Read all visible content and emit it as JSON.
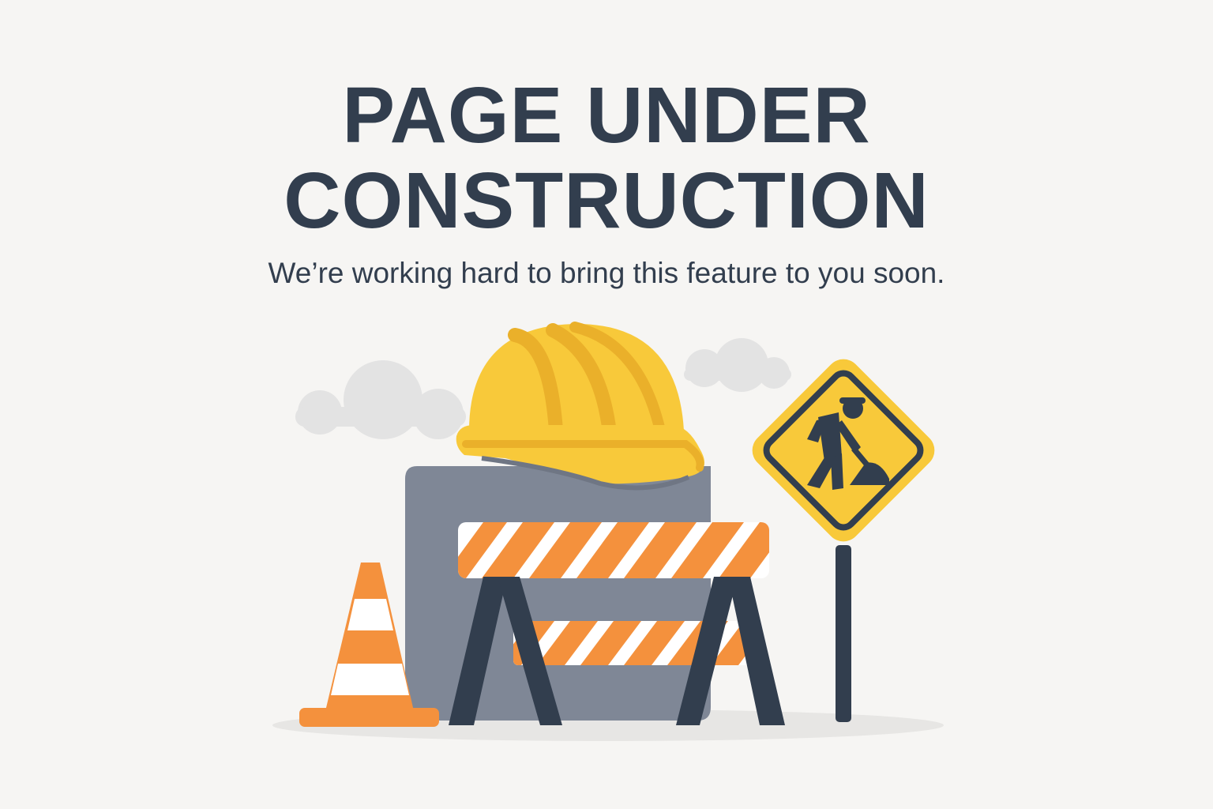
{
  "page": {
    "title_line_1": "PAGE UNDER",
    "title_line_2": "CONSTRUCTION",
    "subtitle": "We’re working hard to bring this feature to you soon."
  },
  "illustration": {
    "icons": [
      "cloud-icon",
      "hard-hat-icon",
      "barrier-icon",
      "traffic-cone-icon",
      "men-at-work-sign-icon"
    ]
  },
  "colors": {
    "background": "#f6f5f3",
    "text": "#323e4e",
    "hard_hat_yellow": "#f8c93a",
    "barrier_orange": "#f4913d",
    "block_gray": "#7f8796",
    "cloud_gray": "#e3e3e3"
  }
}
